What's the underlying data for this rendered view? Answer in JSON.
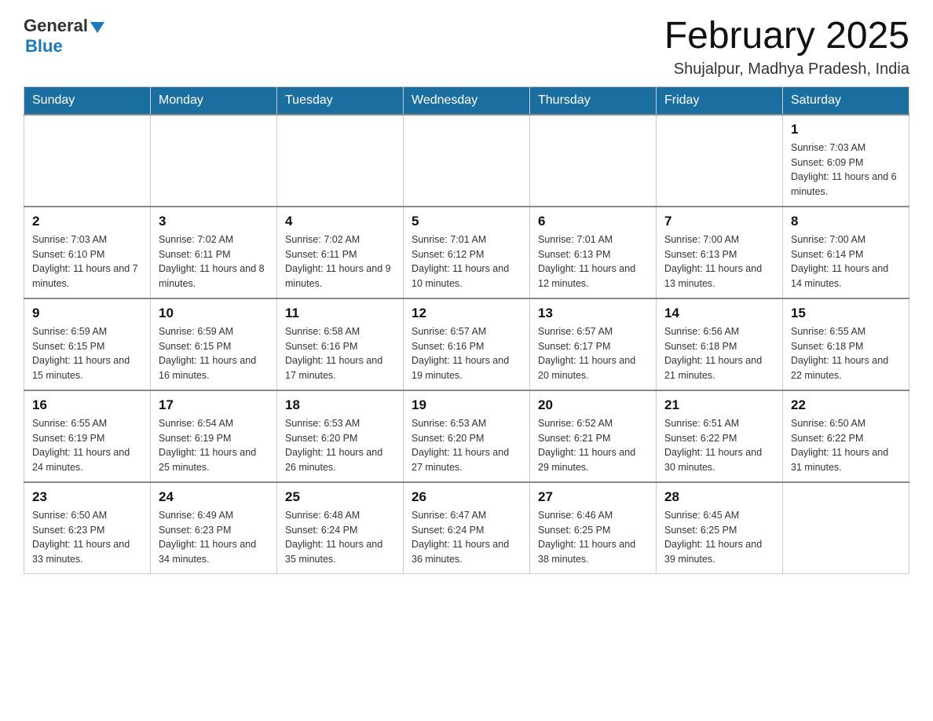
{
  "header": {
    "logo_general": "General",
    "logo_blue": "Blue",
    "month_title": "February 2025",
    "location": "Shujalpur, Madhya Pradesh, India"
  },
  "weekdays": [
    "Sunday",
    "Monday",
    "Tuesday",
    "Wednesday",
    "Thursday",
    "Friday",
    "Saturday"
  ],
  "weeks": [
    {
      "days": [
        {
          "num": "",
          "info": ""
        },
        {
          "num": "",
          "info": ""
        },
        {
          "num": "",
          "info": ""
        },
        {
          "num": "",
          "info": ""
        },
        {
          "num": "",
          "info": ""
        },
        {
          "num": "",
          "info": ""
        },
        {
          "num": "1",
          "info": "Sunrise: 7:03 AM\nSunset: 6:09 PM\nDaylight: 11 hours and 6 minutes."
        }
      ]
    },
    {
      "days": [
        {
          "num": "2",
          "info": "Sunrise: 7:03 AM\nSunset: 6:10 PM\nDaylight: 11 hours and 7 minutes."
        },
        {
          "num": "3",
          "info": "Sunrise: 7:02 AM\nSunset: 6:11 PM\nDaylight: 11 hours and 8 minutes."
        },
        {
          "num": "4",
          "info": "Sunrise: 7:02 AM\nSunset: 6:11 PM\nDaylight: 11 hours and 9 minutes."
        },
        {
          "num": "5",
          "info": "Sunrise: 7:01 AM\nSunset: 6:12 PM\nDaylight: 11 hours and 10 minutes."
        },
        {
          "num": "6",
          "info": "Sunrise: 7:01 AM\nSunset: 6:13 PM\nDaylight: 11 hours and 12 minutes."
        },
        {
          "num": "7",
          "info": "Sunrise: 7:00 AM\nSunset: 6:13 PM\nDaylight: 11 hours and 13 minutes."
        },
        {
          "num": "8",
          "info": "Sunrise: 7:00 AM\nSunset: 6:14 PM\nDaylight: 11 hours and 14 minutes."
        }
      ]
    },
    {
      "days": [
        {
          "num": "9",
          "info": "Sunrise: 6:59 AM\nSunset: 6:15 PM\nDaylight: 11 hours and 15 minutes."
        },
        {
          "num": "10",
          "info": "Sunrise: 6:59 AM\nSunset: 6:15 PM\nDaylight: 11 hours and 16 minutes."
        },
        {
          "num": "11",
          "info": "Sunrise: 6:58 AM\nSunset: 6:16 PM\nDaylight: 11 hours and 17 minutes."
        },
        {
          "num": "12",
          "info": "Sunrise: 6:57 AM\nSunset: 6:16 PM\nDaylight: 11 hours and 19 minutes."
        },
        {
          "num": "13",
          "info": "Sunrise: 6:57 AM\nSunset: 6:17 PM\nDaylight: 11 hours and 20 minutes."
        },
        {
          "num": "14",
          "info": "Sunrise: 6:56 AM\nSunset: 6:18 PM\nDaylight: 11 hours and 21 minutes."
        },
        {
          "num": "15",
          "info": "Sunrise: 6:55 AM\nSunset: 6:18 PM\nDaylight: 11 hours and 22 minutes."
        }
      ]
    },
    {
      "days": [
        {
          "num": "16",
          "info": "Sunrise: 6:55 AM\nSunset: 6:19 PM\nDaylight: 11 hours and 24 minutes."
        },
        {
          "num": "17",
          "info": "Sunrise: 6:54 AM\nSunset: 6:19 PM\nDaylight: 11 hours and 25 minutes."
        },
        {
          "num": "18",
          "info": "Sunrise: 6:53 AM\nSunset: 6:20 PM\nDaylight: 11 hours and 26 minutes."
        },
        {
          "num": "19",
          "info": "Sunrise: 6:53 AM\nSunset: 6:20 PM\nDaylight: 11 hours and 27 minutes."
        },
        {
          "num": "20",
          "info": "Sunrise: 6:52 AM\nSunset: 6:21 PM\nDaylight: 11 hours and 29 minutes."
        },
        {
          "num": "21",
          "info": "Sunrise: 6:51 AM\nSunset: 6:22 PM\nDaylight: 11 hours and 30 minutes."
        },
        {
          "num": "22",
          "info": "Sunrise: 6:50 AM\nSunset: 6:22 PM\nDaylight: 11 hours and 31 minutes."
        }
      ]
    },
    {
      "days": [
        {
          "num": "23",
          "info": "Sunrise: 6:50 AM\nSunset: 6:23 PM\nDaylight: 11 hours and 33 minutes."
        },
        {
          "num": "24",
          "info": "Sunrise: 6:49 AM\nSunset: 6:23 PM\nDaylight: 11 hours and 34 minutes."
        },
        {
          "num": "25",
          "info": "Sunrise: 6:48 AM\nSunset: 6:24 PM\nDaylight: 11 hours and 35 minutes."
        },
        {
          "num": "26",
          "info": "Sunrise: 6:47 AM\nSunset: 6:24 PM\nDaylight: 11 hours and 36 minutes."
        },
        {
          "num": "27",
          "info": "Sunrise: 6:46 AM\nSunset: 6:25 PM\nDaylight: 11 hours and 38 minutes."
        },
        {
          "num": "28",
          "info": "Sunrise: 6:45 AM\nSunset: 6:25 PM\nDaylight: 11 hours and 39 minutes."
        },
        {
          "num": "",
          "info": ""
        }
      ]
    }
  ]
}
